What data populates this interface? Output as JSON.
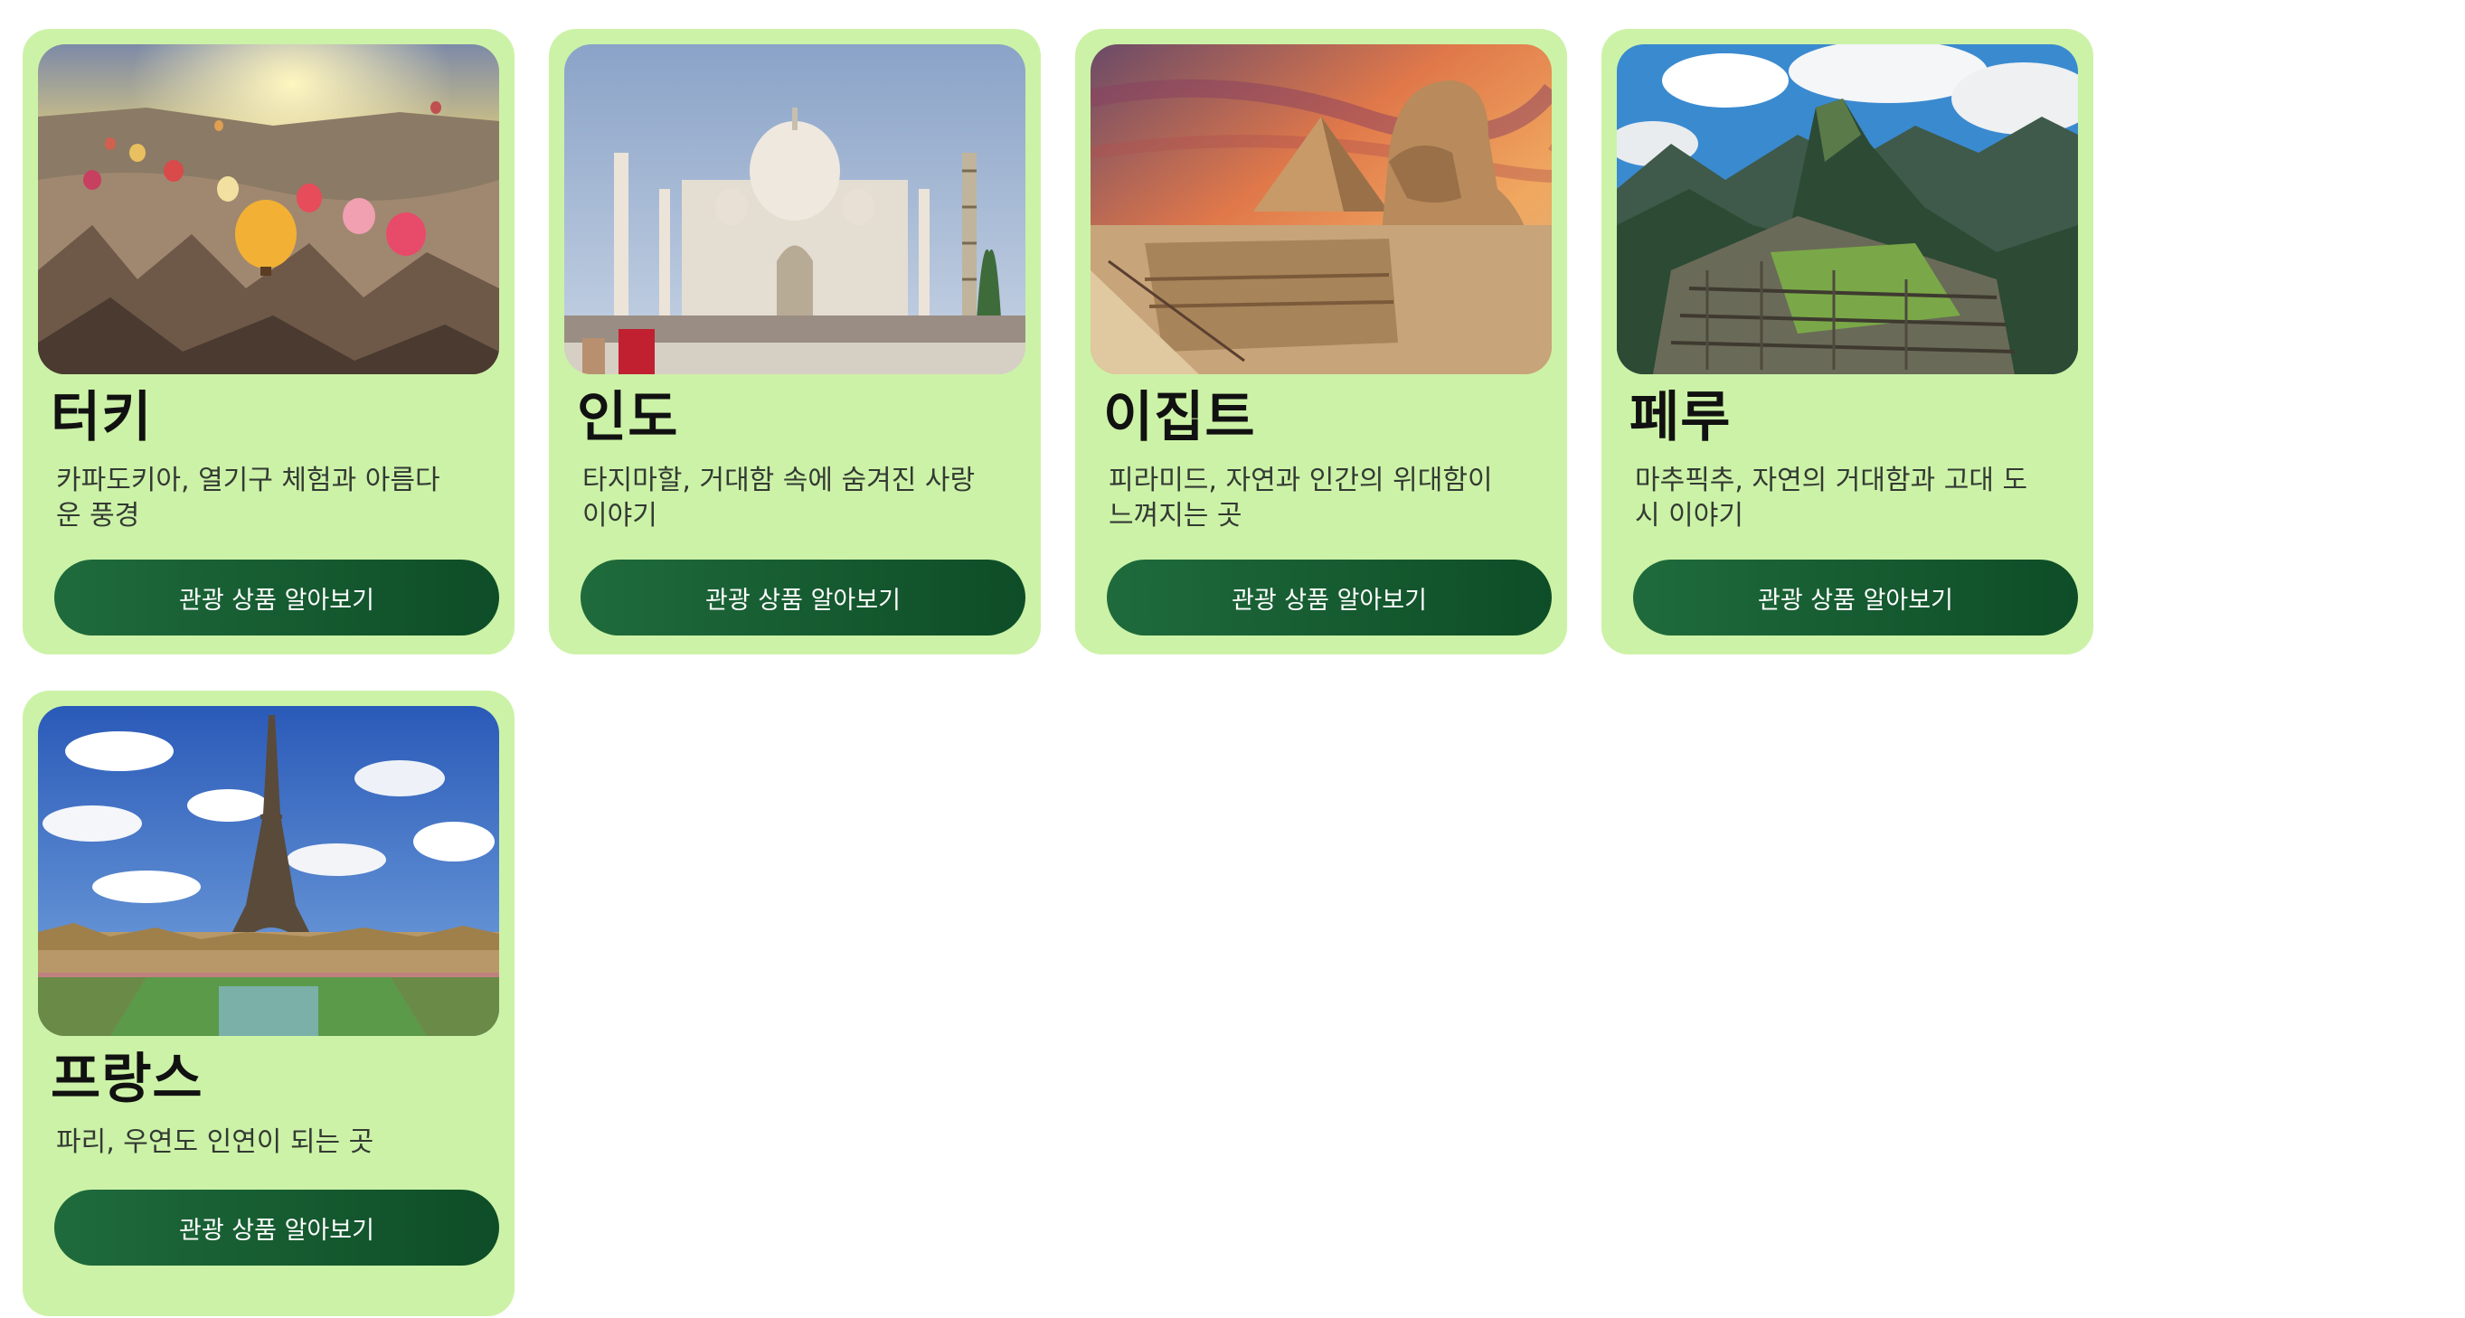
{
  "cards": [
    {
      "title": "터키",
      "description": "카파도키아, 열기구 체험과 아름다운 풍경",
      "button_label": "관광 상품 알아보기",
      "image_icon": "hot-air-balloons-photo"
    },
    {
      "title": "인도",
      "description": "타지마할, 거대함 속에 숨겨진 사랑 이야기",
      "button_label": "관광 상품 알아보기",
      "image_icon": "taj-mahal-photo"
    },
    {
      "title": "이집트",
      "description": "피라미드, 자연과 인간의 위대함이 느껴지는 곳",
      "button_label": "관광 상품 알아보기",
      "image_icon": "pyramid-sphinx-photo"
    },
    {
      "title": "페루",
      "description": "마추픽추, 자연의 거대함과 고대 도시 이야기",
      "button_label": "관광 상품 알아보기",
      "image_icon": "machu-picchu-photo"
    },
    {
      "title": "프랑스",
      "description": "파리, 우연도 인연이 되는 곳",
      "button_label": "관광 상품 알아보기",
      "image_icon": "eiffel-tower-photo"
    }
  ],
  "colors": {
    "card_bg": "#ccf2a7",
    "button_bg": "#1f6b3c",
    "title": "#111111"
  }
}
